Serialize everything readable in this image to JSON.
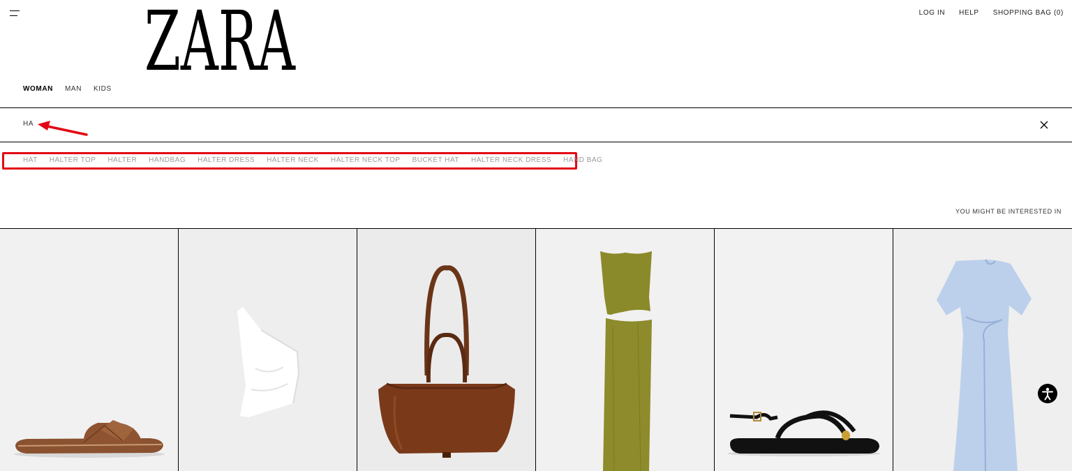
{
  "header": {
    "logo_text": "ZARA",
    "nav": {
      "login": "LOG IN",
      "help": "HELP",
      "bag": "SHOPPING BAG (0)"
    }
  },
  "gender_tabs": [
    {
      "label": "WOMAN",
      "active": true
    },
    {
      "label": "MAN",
      "active": false
    },
    {
      "label": "KIDS",
      "active": false
    }
  ],
  "search": {
    "value": "HA"
  },
  "suggestions": [
    "HAT",
    "HALTER TOP",
    "HALTER",
    "HANDBAG",
    "HALTER DRESS",
    "HALTER NECK",
    "HALTER NECK TOP",
    "BUCKET HAT",
    "HALTER NECK DRESS",
    "HAND BAG"
  ],
  "recommend_heading": "YOU MIGHT BE INTERESTED IN",
  "products": [
    {
      "kind": "sandal-icon",
      "bg": "#f1f1f1"
    },
    {
      "kind": "top-icon",
      "bg": "#eeeeee"
    },
    {
      "kind": "bag-icon",
      "bg": "#ebebeb"
    },
    {
      "kind": "dress-icon",
      "bg": "#f1f1f1"
    },
    {
      "kind": "strap-sandal-icon",
      "bg": "#f2f2f2"
    },
    {
      "kind": "blue-dress-icon",
      "bg": "#efefef"
    }
  ],
  "colors": {
    "highlight": "#e30613",
    "text": "#000000",
    "muted": "#9a9a9a"
  }
}
